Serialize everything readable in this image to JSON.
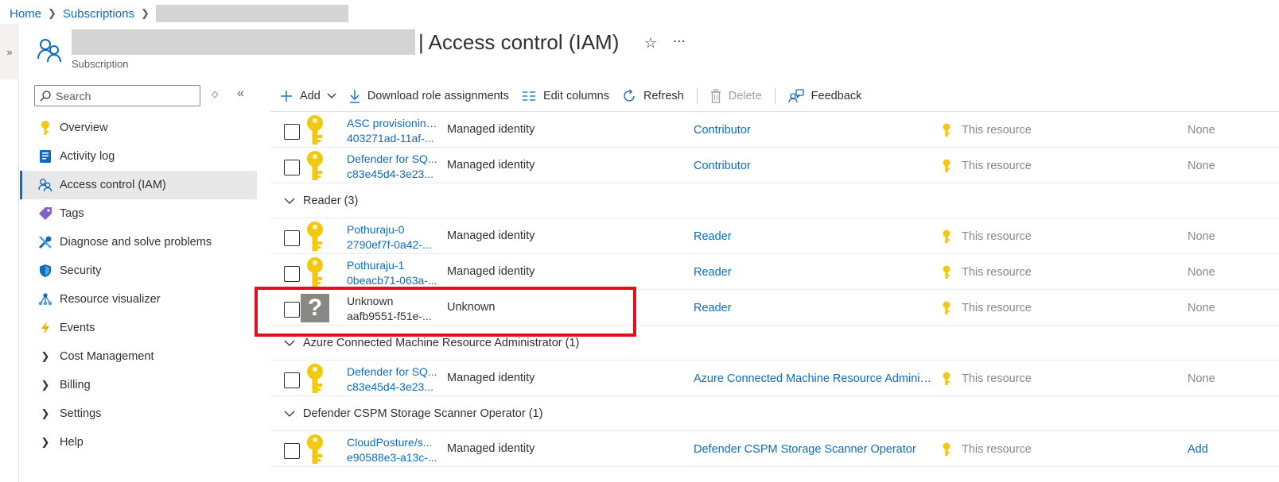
{
  "breadcrumb": {
    "home": "Home",
    "subscriptions": "Subscriptions"
  },
  "header": {
    "title": "| Access control (IAM)",
    "subtitle": "Subscription"
  },
  "search": {
    "placeholder": "Search"
  },
  "nav": {
    "items": [
      {
        "label": "Overview",
        "icon": "overview-key-icon"
      },
      {
        "label": "Activity log",
        "icon": "activity-log-icon"
      },
      {
        "label": "Access control (IAM)",
        "icon": "iam-people-icon"
      },
      {
        "label": "Tags",
        "icon": "tag-icon"
      },
      {
        "label": "Diagnose and solve problems",
        "icon": "wrench-icon"
      },
      {
        "label": "Security",
        "icon": "shield-icon"
      },
      {
        "label": "Resource visualizer",
        "icon": "visualizer-icon"
      },
      {
        "label": "Events",
        "icon": "lightning-icon"
      },
      {
        "label": "Cost Management",
        "icon": "chevron-right-icon"
      },
      {
        "label": "Billing",
        "icon": "chevron-right-icon"
      },
      {
        "label": "Settings",
        "icon": "chevron-right-icon"
      },
      {
        "label": "Help",
        "icon": "chevron-right-icon"
      }
    ]
  },
  "toolbar": {
    "add": "Add",
    "download": "Download role assignments",
    "edit_columns": "Edit columns",
    "refresh": "Refresh",
    "delete": "Delete",
    "feedback": "Feedback"
  },
  "grid": {
    "rows_top": [
      {
        "name": "ASC provisioning...",
        "oid": "403271ad-11af-...",
        "type": "Managed identity",
        "role": "Contributor",
        "scope": "This resource",
        "condition": "None"
      },
      {
        "name": "Defender for SQ...",
        "oid": "c83e45d4-3e23...",
        "type": "Managed identity",
        "role": "Contributor",
        "scope": "This resource",
        "condition": "None"
      }
    ],
    "group_reader": "Reader (3)",
    "rows_reader": [
      {
        "name": "Pothuraju-0",
        "oid": "2790ef7f-0a42-...",
        "type": "Managed identity",
        "role": "Reader",
        "scope": "This resource",
        "condition": "None"
      },
      {
        "name": "Pothuraju-1",
        "oid": "0beacb71-063a-...",
        "type": "Managed identity",
        "role": "Reader",
        "scope": "This resource",
        "condition": "None"
      },
      {
        "name": "Unknown",
        "oid": "aafb9551-f51e-...",
        "type": "Unknown",
        "role": "Reader",
        "scope": "This resource",
        "condition": "None"
      }
    ],
    "group_azure": "Azure Connected Machine Resource Administrator (1)",
    "rows_azure": [
      {
        "name": "Defender for SQ...",
        "oid": "c83e45d4-3e23...",
        "type": "Managed identity",
        "role": "Azure Connected Machine Resource Adminis...",
        "scope": "This resource",
        "condition": "None"
      }
    ],
    "group_cspm": "Defender CSPM Storage Scanner Operator (1)",
    "rows_cspm": [
      {
        "name": "CloudPosture/s...",
        "oid": "e90588e3-a13c-...",
        "type": "Managed identity",
        "role": "Defender CSPM Storage Scanner Operator",
        "scope": "This resource",
        "condition": "Add"
      }
    ]
  },
  "colors": {
    "accent": "#0f6cbd",
    "highlight": "#e0101f",
    "key": "#f2c811"
  }
}
